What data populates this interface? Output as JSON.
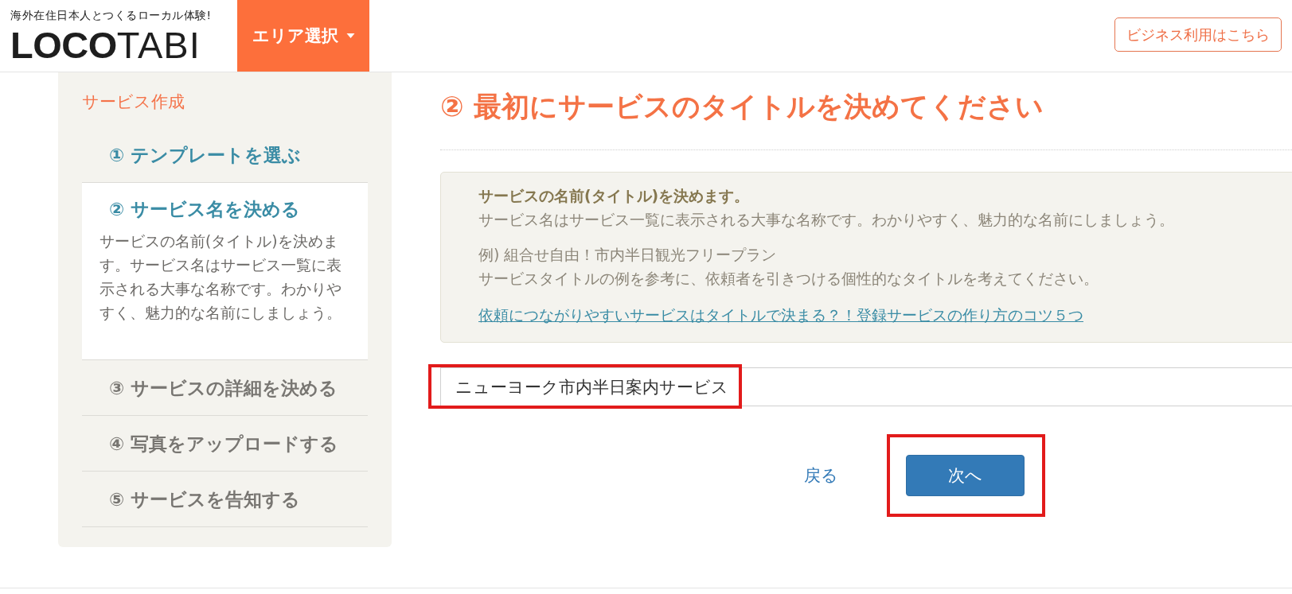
{
  "header": {
    "tagline": "海外在住日本人とつくるローカル体験!",
    "logo": "**LOCO**TABI",
    "area_menu": "エリア選択",
    "business_link": "ビジネス利用はこちら"
  },
  "sidebar": {
    "title": "サービス作成",
    "steps": [
      {
        "label": "① テンプレートを選ぶ",
        "selected": false,
        "reached": true
      },
      {
        "label": "② サービス名を決める",
        "selected": true,
        "reached": true,
        "description": "サービスの名前(タイトル)を決めます。サービス名はサービス一覧に表示される大事な名称です。わかりやすく、魅力的な名前にしましょう。"
      },
      {
        "label": "③ サービスの詳細を決める",
        "selected": false,
        "reached": false
      },
      {
        "label": "④ 写真をアップロードする",
        "selected": false,
        "reached": false
      },
      {
        "label": "⑤ サービスを告知する",
        "selected": false,
        "reached": false
      }
    ]
  },
  "main": {
    "heading": "② 最初にサービスのタイトルを決めてください",
    "info": {
      "heading": "サービスの名前(タイトル)を決めます。",
      "paragraphs": [
        [
          "サービス名はサービス一覧に表示される大事な名称です。わかりやすく、魅力的な名前にしましょう。"
        ],
        [
          "例) 組合せ自由！市内半日観光フリープラン",
          "サービスタイトルの例を参考に、依頼者を引きつける個性的なタイトルを考えてください。"
        ]
      ],
      "link": "依頼につながりやすいサービスはタイトルで決まる？！登録サービスの作り方のコツ５つ"
    },
    "title_field": {
      "value": "ニューヨーク市内半日案内サービス",
      "highlighted": true
    },
    "back_link": "戻る",
    "next_button": {
      "label": "次へ",
      "highlighted": true
    }
  }
}
